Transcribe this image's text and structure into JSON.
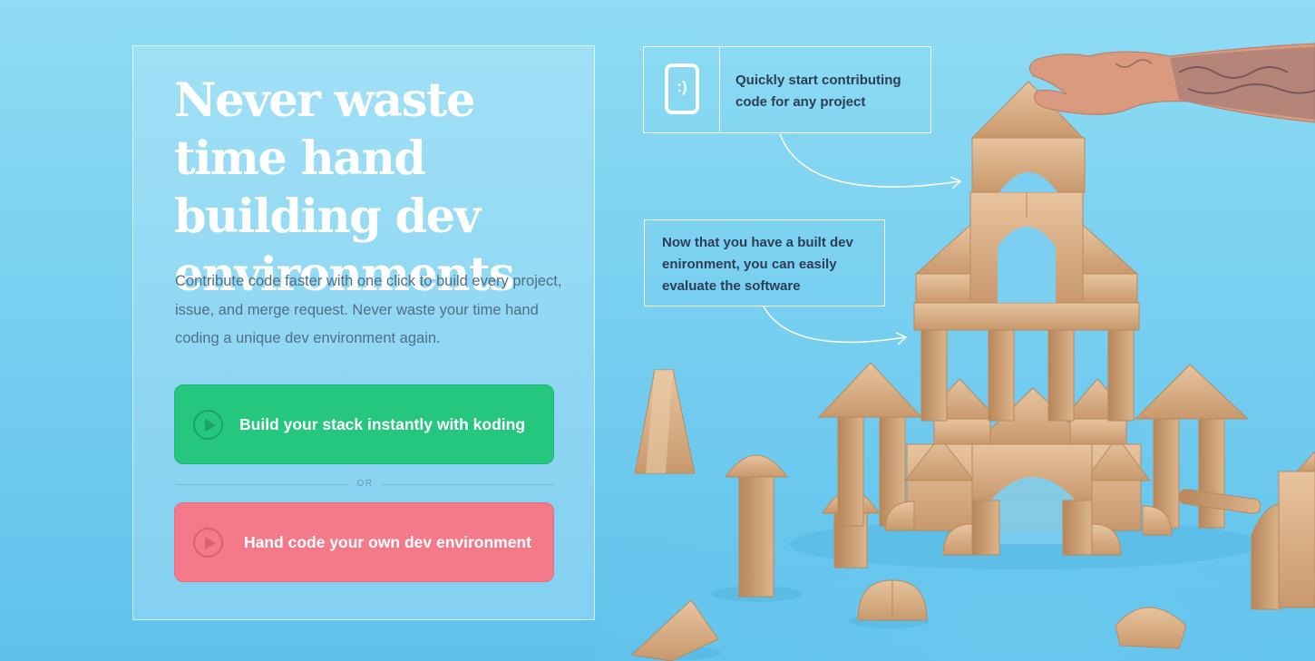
{
  "hero": {
    "headline": "Never waste time hand building dev environments",
    "lead": "Contribute code faster with one click to build every project, issue, and merge request. Never waste your time hand coding a unique dev environment again."
  },
  "actions": {
    "primary_label": "Build your stack instantly with koding",
    "divider_label": "OR",
    "secondary_label": "Hand code your own dev environment"
  },
  "callouts": [
    {
      "text": "Quickly start contributing code for any project",
      "icon": "smiley-phone-icon"
    },
    {
      "text": "Now that you have a built dev enironment, you can easily evaluate the software"
    }
  ],
  "colors": {
    "background": "#7fd3f1",
    "primary_button": "#25c77e",
    "secondary_button": "#f47a89",
    "callout_text": "#2c3e55",
    "wood": "#dcb48c"
  }
}
